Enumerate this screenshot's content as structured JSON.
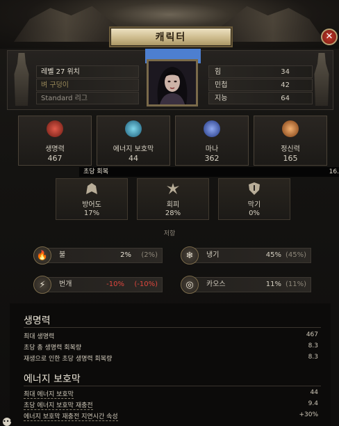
{
  "window": {
    "title": "캐릭터"
  },
  "header": {
    "level_class": "레벨 27 위치",
    "clan": "벼 구덩이",
    "realm": "Standard 리그",
    "attributes": [
      {
        "label": "힘",
        "value": "34"
      },
      {
        "label": "민첩",
        "value": "42"
      },
      {
        "label": "지능",
        "value": "64"
      }
    ]
  },
  "stats": [
    {
      "label": "생명력",
      "value": "467",
      "icon": "heart-icon",
      "color": "#c0392b"
    },
    {
      "label": "에너지 보호막",
      "value": "44",
      "icon": "shield-crest-icon",
      "color": "#3aa6c9"
    },
    {
      "label": "마나",
      "value": "362",
      "icon": "mana-icon",
      "color": "#4a6fd6"
    },
    {
      "label": "정신력",
      "value": "165",
      "icon": "spirit-icon",
      "color": "#e07a2a"
    }
  ],
  "regen": {
    "label": "초당 회복",
    "value": "16."
  },
  "defense": [
    {
      "label": "방어도",
      "value": "17%",
      "icon": "armour-icon"
    },
    {
      "label": "회피",
      "value": "28%",
      "icon": "evasion-icon"
    },
    {
      "label": "막기",
      "value": "0%",
      "icon": "block-icon"
    }
  ],
  "resist": {
    "title": "저항",
    "items": [
      {
        "label": "불",
        "value": "2%",
        "max": "(2%)",
        "icon": "fire-icon",
        "glyph": "🔥"
      },
      {
        "label": "냉기",
        "value": "45%",
        "max": "(45%)",
        "icon": "cold-icon",
        "glyph": "❄"
      },
      {
        "label": "번개",
        "value": "-10%",
        "max": "(-10%)",
        "icon": "lightning-icon",
        "glyph": "⚡"
      },
      {
        "label": "카오스",
        "value": "11%",
        "max": "(11%)",
        "icon": "chaos-icon",
        "glyph": "◎"
      }
    ]
  },
  "details": {
    "life": {
      "title": "생명력",
      "rows": [
        {
          "label": "최대 생명력",
          "value": "467"
        },
        {
          "label": "초당 총 생명력 회복량",
          "value": "8.3"
        },
        {
          "label": "재생으로 인한 초당 생명력 회복량",
          "value": "8.3"
        }
      ]
    },
    "es": {
      "title": "에너지 보호막",
      "rows": [
        {
          "label": "최대 에너지 보호막",
          "value": "44"
        },
        {
          "label": "초당 에너지 보호막 재충전",
          "value": "9.4"
        },
        {
          "label": "에너지 보호막 재충전 지연시간 속성",
          "value": "+30%"
        }
      ]
    }
  },
  "scroll_hint": "•••"
}
